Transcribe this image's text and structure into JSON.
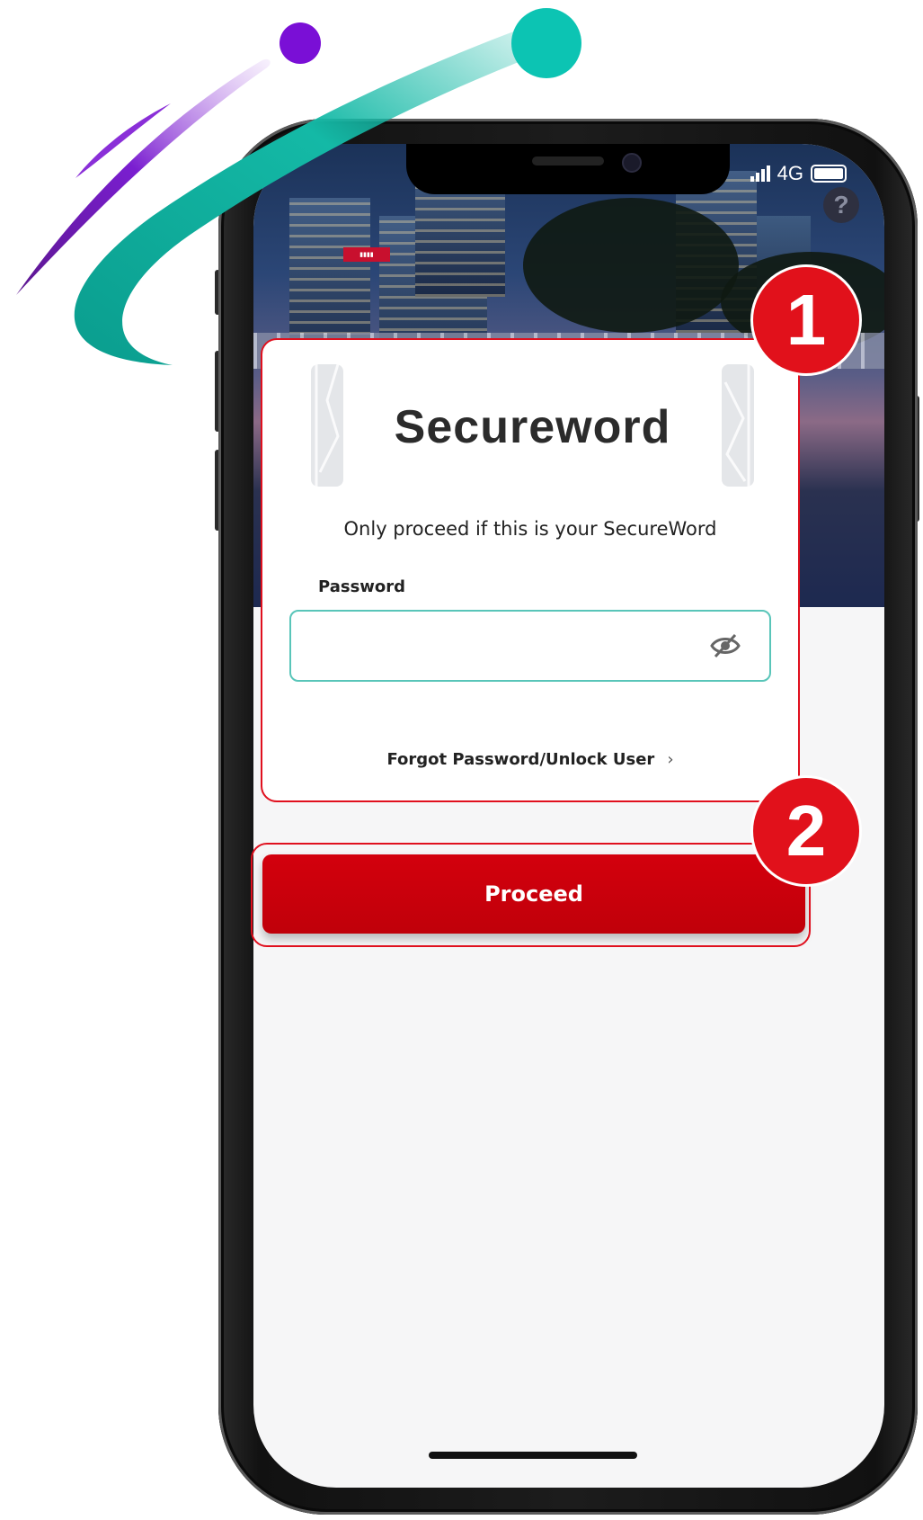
{
  "status_bar": {
    "network": "4G"
  },
  "help_icon": {
    "symbol": "?"
  },
  "secureword_card": {
    "secure_word": "Secureword",
    "hint": "Only proceed if this is your SecureWord",
    "password_label": "Password",
    "password_value": "",
    "forgot_link": "Forgot Password/Unlock User",
    "forgot_chevron": "›"
  },
  "proceed_button": {
    "label": "Proceed"
  },
  "annotations": {
    "badge_1": "1",
    "badge_2": "2"
  },
  "colors": {
    "accent_red": "#e1111b",
    "button_red": "#c8000c",
    "field_border": "#59c5b9",
    "deco_teal": "#0fbfa8",
    "deco_purple": "#7a1ed0"
  },
  "icons": [
    "help-icon",
    "eye-slash-icon",
    "chevron-right-icon",
    "signal-icon",
    "battery-icon"
  ]
}
